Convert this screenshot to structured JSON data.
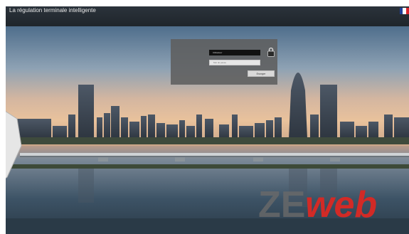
{
  "header": {
    "title": "La régulation terminale intelligente",
    "language_flag": {
      "icon": "french-flag-icon",
      "colors": [
        "#1f3f9a",
        "#ffffff",
        "#d9252e"
      ]
    }
  },
  "login": {
    "username_value": "Utilisateur",
    "password_placeholder": "Mot de passe",
    "submit_label": "Envoyer",
    "lock_icon": "padlock-icon"
  },
  "branding": {
    "logo_text_gray": "ZE",
    "logo_text_red": "web",
    "colors": {
      "gray": "#6a6a6a",
      "red": "#d22a26"
    }
  },
  "background": {
    "description_icon": "city-skyline-sunset-photo"
  }
}
